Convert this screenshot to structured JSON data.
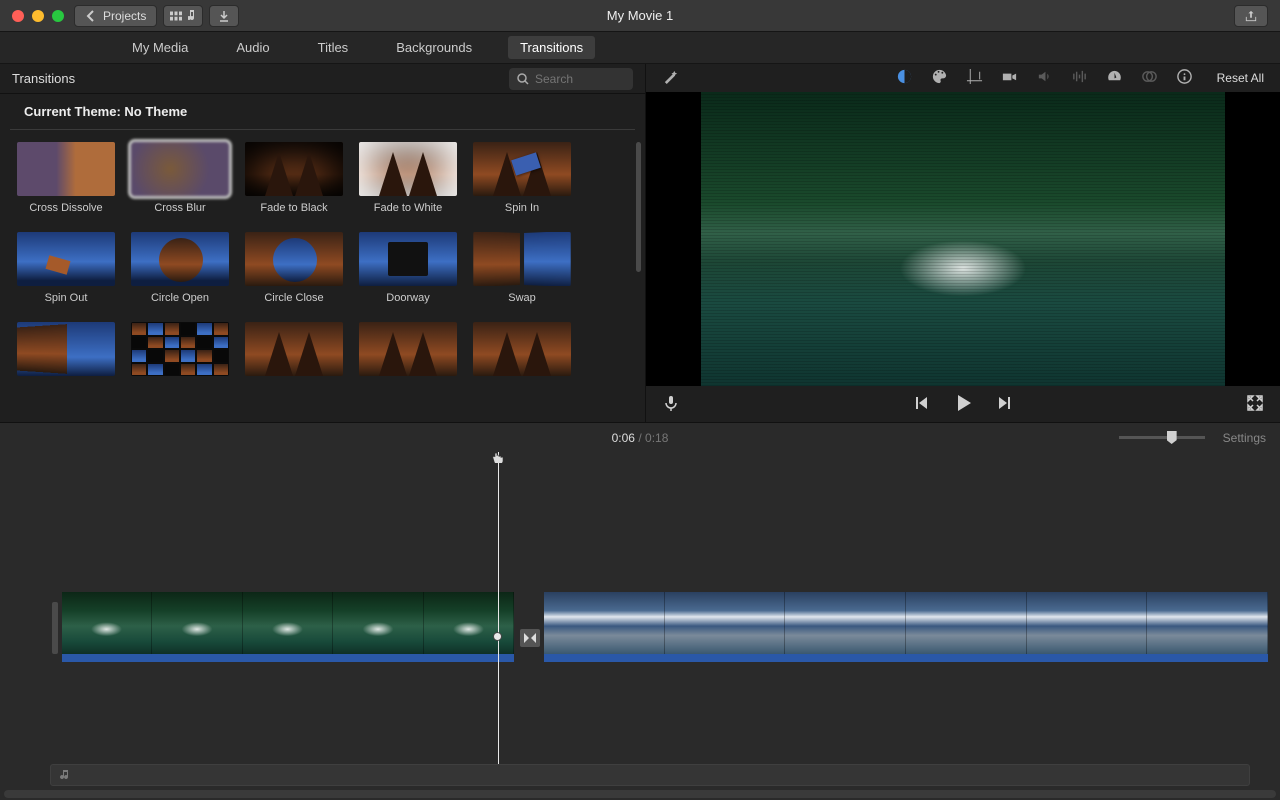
{
  "window": {
    "title": "My Movie 1",
    "back_button": "Projects"
  },
  "tabs": {
    "my_media": "My Media",
    "audio": "Audio",
    "titles": "Titles",
    "backgrounds": "Backgrounds",
    "transitions": "Transitions"
  },
  "browser": {
    "panel_title": "Transitions",
    "search_placeholder": "Search",
    "theme_label": "Current Theme: No Theme",
    "transitions": [
      "Cross Dissolve",
      "Cross Blur",
      "Fade to Black",
      "Fade to White",
      "Spin In",
      "Spin Out",
      "Circle Open",
      "Circle Close",
      "Doorway",
      "Swap"
    ],
    "selected_index": 1
  },
  "viewer": {
    "reset": "Reset All"
  },
  "timeline": {
    "current": "0:06",
    "total": "0:18",
    "separator": "/",
    "settings": "Settings"
  }
}
